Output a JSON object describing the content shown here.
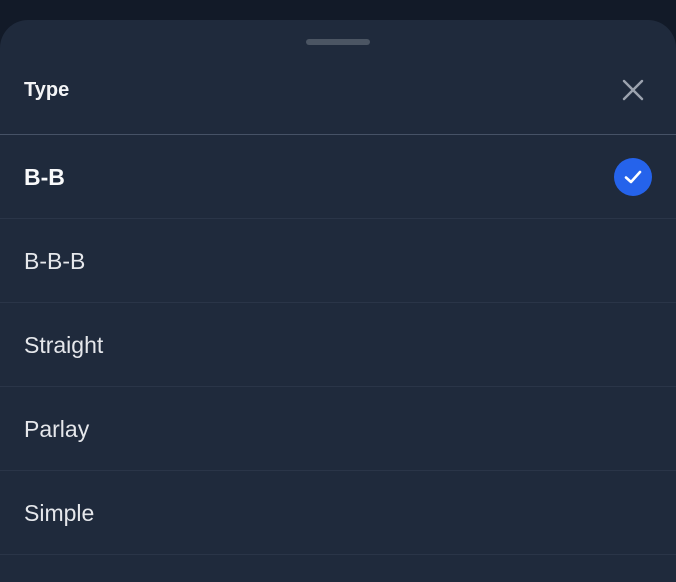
{
  "sheet": {
    "title": "Type",
    "close_icon": "close-icon"
  },
  "options": [
    {
      "label": "B-B",
      "selected": true
    },
    {
      "label": "B-B-B",
      "selected": false
    },
    {
      "label": "Straight",
      "selected": false
    },
    {
      "label": "Parlay",
      "selected": false
    },
    {
      "label": "Simple",
      "selected": false
    }
  ],
  "colors": {
    "sheet_bg": "#1f2a3c",
    "accent": "#2563eb",
    "text": "#e5e7eb"
  }
}
